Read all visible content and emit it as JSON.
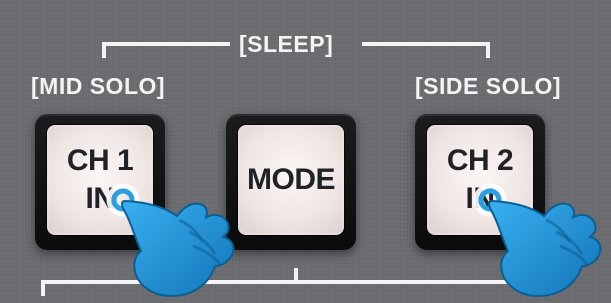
{
  "labels": {
    "sleep": "[SLEEP]",
    "mid_solo": "[MID SOLO]",
    "side_solo": "[SIDE SOLO]"
  },
  "buttons": [
    {
      "label": "CH 1\nIN"
    },
    {
      "label": "MODE"
    },
    {
      "label": "CH 2\nIN"
    }
  ],
  "colors": {
    "panel": "#6b6c70",
    "text_light": "#f4f4f4",
    "key_body": "#111111",
    "key_cap": "#f2e9e7",
    "hand": "#1f97d9"
  },
  "icons": [
    "hand-pointer-icon",
    "hand-pointer-icon"
  ]
}
